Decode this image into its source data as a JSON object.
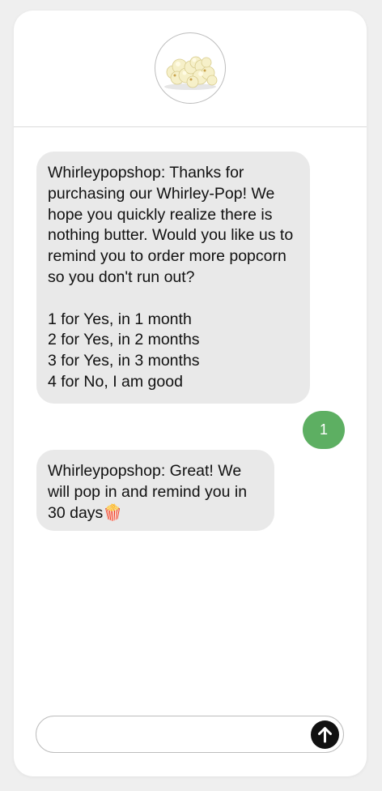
{
  "contact": {
    "avatar_icon": "popcorn-image"
  },
  "messages": [
    {
      "direction": "incoming",
      "text": "Whirleypopshop: Thanks for purchasing our Whirley-Pop! We hope you quickly realize there is nothing butter. Would you like us to remind you to order more popcorn so you don't run out?\n\n1 for Yes, in 1 month\n2 for Yes, in 2 months\n3 for Yes, in 3 months\n4 for No, I am good"
    },
    {
      "direction": "outgoing",
      "text": "1"
    },
    {
      "direction": "incoming",
      "text": "Whirleypopshop: Great! We will pop in and remind you in 30 days🍿"
    }
  ],
  "composer": {
    "value": "",
    "placeholder": "",
    "send_icon": "arrow-up-icon"
  },
  "colors": {
    "incoming_bubble": "#e9e9e9",
    "outgoing_bubble": "#5daf62",
    "send_button": "#111111",
    "background": "#efefef"
  }
}
